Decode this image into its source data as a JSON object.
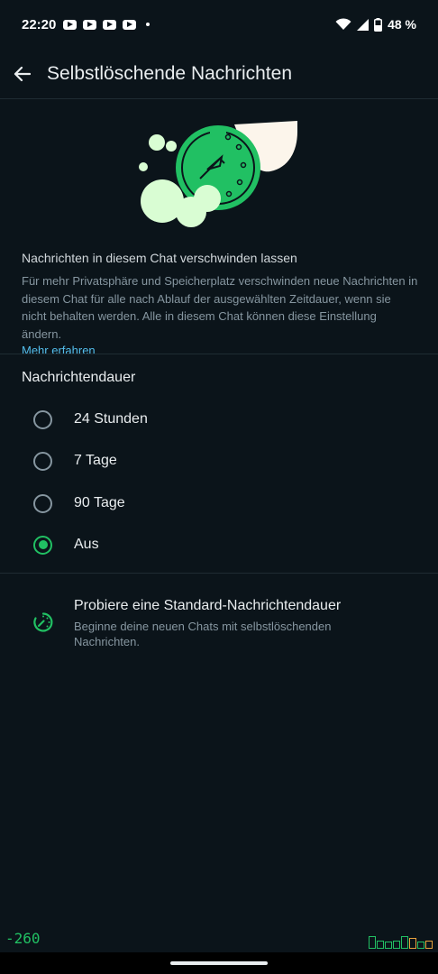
{
  "status": {
    "time": "22:20",
    "battery": "48 %"
  },
  "header": {
    "title": "Selbstlöschende Nachrichten",
    "icons": {
      "back": "arrow-back-icon"
    }
  },
  "intro": {
    "title": "Nachrichten in diesem Chat verschwinden lassen",
    "description": "Für mehr Privatsphäre und Speicherplatz verschwinden neue Nachrichten in diesem Chat für alle nach Ablauf der ausgewählten Zeitdauer, wenn sie nicht behalten werden. Alle in diesem Chat können diese Einstellung ändern.",
    "link": "Mehr erfahren"
  },
  "duration": {
    "label": "Nachrichtendauer",
    "options": [
      {
        "label": "24 Stunden",
        "selected": false
      },
      {
        "label": "7 Tage",
        "selected": false
      },
      {
        "label": "90 Tage",
        "selected": false
      },
      {
        "label": "Aus",
        "selected": true
      }
    ]
  },
  "promo": {
    "title": "Probiere eine Standard-Nachrichtendauer",
    "description": "Beginne deine neuen Chats mit selbstlöschenden Nachrichten.",
    "icon": "timer-icon"
  },
  "debug": {
    "value": "-260"
  },
  "colors": {
    "background": "#0b141a",
    "accent": "#21c063",
    "link": "#53bdeb"
  }
}
